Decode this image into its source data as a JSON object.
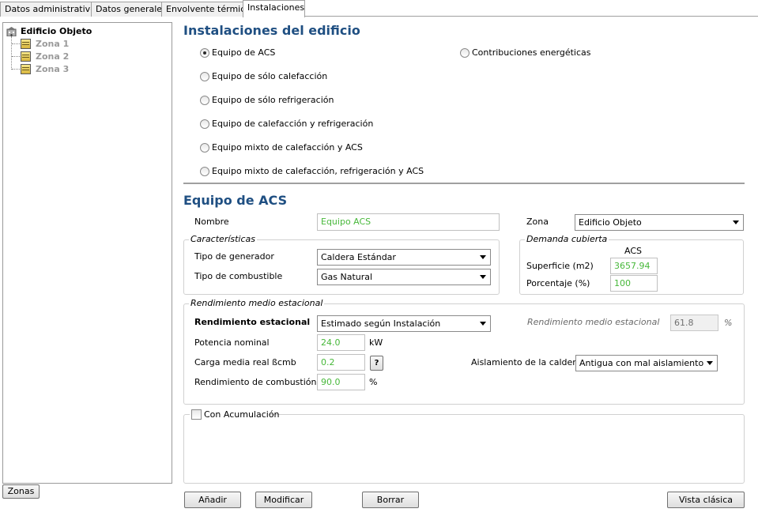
{
  "tabs": [
    {
      "label": "Datos administrativos"
    },
    {
      "label": "Datos generales"
    },
    {
      "label": "Envolvente térmica"
    },
    {
      "label": "Instalaciones"
    }
  ],
  "tree": {
    "root": "Edificio Objeto",
    "zones": [
      "Zona 1",
      "Zona 2",
      "Zona 3"
    ]
  },
  "zonas_button": "Zonas",
  "installations": {
    "title": "Instalaciones del edificio",
    "options": [
      "Equipo de ACS",
      "Equipo de sólo calefacción",
      "Equipo de sólo refrigeración",
      "Equipo de calefacción y refrigeración",
      "Equipo mixto de calefacción y ACS",
      "Equipo mixto de calefacción, refrigeración y ACS"
    ],
    "contrib_label": "Contribuciones energéticas",
    "selected": "Equipo de ACS"
  },
  "equipo": {
    "title": "Equipo de ACS",
    "nombre_label": "Nombre",
    "nombre_value": "Equipo ACS",
    "zona_label": "Zona",
    "zona_value": "Edificio Objeto"
  },
  "caracteristicas": {
    "title": "Características",
    "generador_label": "Tipo de generador",
    "generador_value": "Caldera Estándar",
    "combustible_label": "Tipo de combustible",
    "combustible_value": "Gas Natural"
  },
  "demanda": {
    "title": "Demanda cubierta",
    "col_header": "ACS",
    "superficie_label": "Superficie (m2)",
    "superficie_value": "3657.94",
    "porcentaje_label": "Porcentaje (%)",
    "porcentaje_value": "100"
  },
  "rendimiento": {
    "title": "Rendimiento medio estacional",
    "estacional_label": "Rendimiento estacional",
    "estacional_value": "Estimado según Instalación",
    "medio_label": "Rendimiento medio estacional",
    "medio_value": "61.8",
    "medio_unit": "%",
    "potencia_label": "Potencia nominal",
    "potencia_value": "24.0",
    "potencia_unit": "kW",
    "carga_label": "Carga media real ßcmb",
    "carga_value": "0.2",
    "help_label": "?",
    "aislamiento_label": "Aislamiento de la caldera",
    "aislamiento_value": "Antigua con mal aislamiento",
    "combustion_label": "Rendimiento de combustión",
    "combustion_value": "90.0",
    "combustion_unit": "%"
  },
  "acumulacion": {
    "label": "Con Acumulación",
    "checked": false
  },
  "buttons": {
    "anadir": "Añadir",
    "modificar": "Modificar",
    "borrar": "Borrar",
    "vista": "Vista clásica"
  },
  "colors": {
    "heading": "#1f4f82",
    "value_green": "#47b83a"
  }
}
